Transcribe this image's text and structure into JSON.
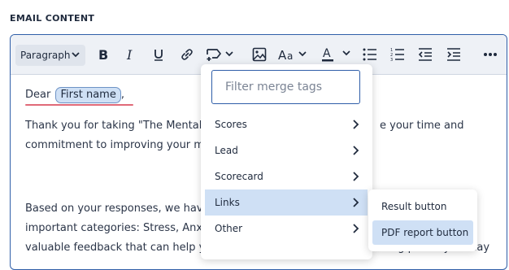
{
  "section": {
    "title": "EMAIL CONTENT"
  },
  "toolbar": {
    "paragraph_select": "Paragraph",
    "buttons": [
      "bold-icon",
      "italic-icon",
      "underline-icon",
      "link-icon",
      "merge-tag-icon",
      "image-icon",
      "font-size-icon",
      "text-color-icon",
      "bulleted-list-icon",
      "numbered-list-icon",
      "outdent-icon",
      "indent-icon",
      "more-icon"
    ],
    "colors": {
      "toolbar_bg": "#eef1f6",
      "accent": "#2f5ea8"
    }
  },
  "body": {
    "greeting_prefix": "Dear",
    "merge_tag": "First name",
    "line1": "Thank you for taking \"The Mental I",
    "line1_right": "e your time and",
    "line2": "commitment to improving your me",
    "line3": "Based on your responses, we have c",
    "line4": "important categories: Stress, Anxie",
    "line5": "valuable feedback that can help you address any challenges or sticking points you may"
  },
  "dropdown": {
    "filter_placeholder": "Filter merge tags",
    "items": [
      {
        "label": "Scores"
      },
      {
        "label": "Lead"
      },
      {
        "label": "Scorecard"
      },
      {
        "label": "Links"
      },
      {
        "label": "Other"
      }
    ],
    "active_index": 3
  },
  "submenu": {
    "items": [
      {
        "label": "Result button"
      },
      {
        "label": "PDF report button"
      }
    ],
    "highlight_index": 1
  }
}
